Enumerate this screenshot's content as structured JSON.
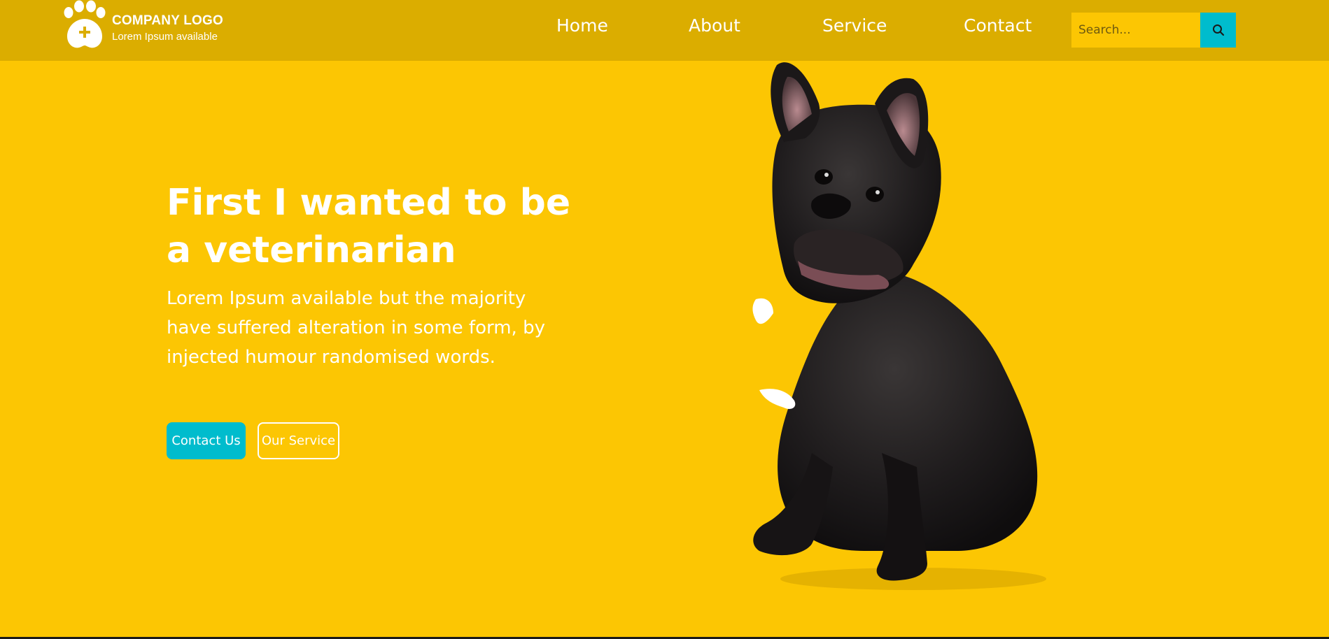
{
  "brand": {
    "title": "COMPANY LOGO",
    "subtitle": "Lorem Ipsum available"
  },
  "nav": {
    "home": "Home",
    "about": "About",
    "service": "Service",
    "contact": "Contact"
  },
  "search": {
    "placeholder": "Search..."
  },
  "hero": {
    "title_line1": "First I wanted to be",
    "title_line2": "a veterinarian",
    "text": "Lorem Ipsum available but the majority have suffered alteration in some form, by injected humour randomised words.",
    "contact_button": "Contact Us",
    "service_button": "Our Service"
  },
  "icons": {
    "logo": "paw-plus-icon",
    "search": "search-icon"
  },
  "colors": {
    "background": "#fcc603",
    "header": "#dbad00",
    "accent": "#00bccd",
    "text": "#ffffff"
  }
}
